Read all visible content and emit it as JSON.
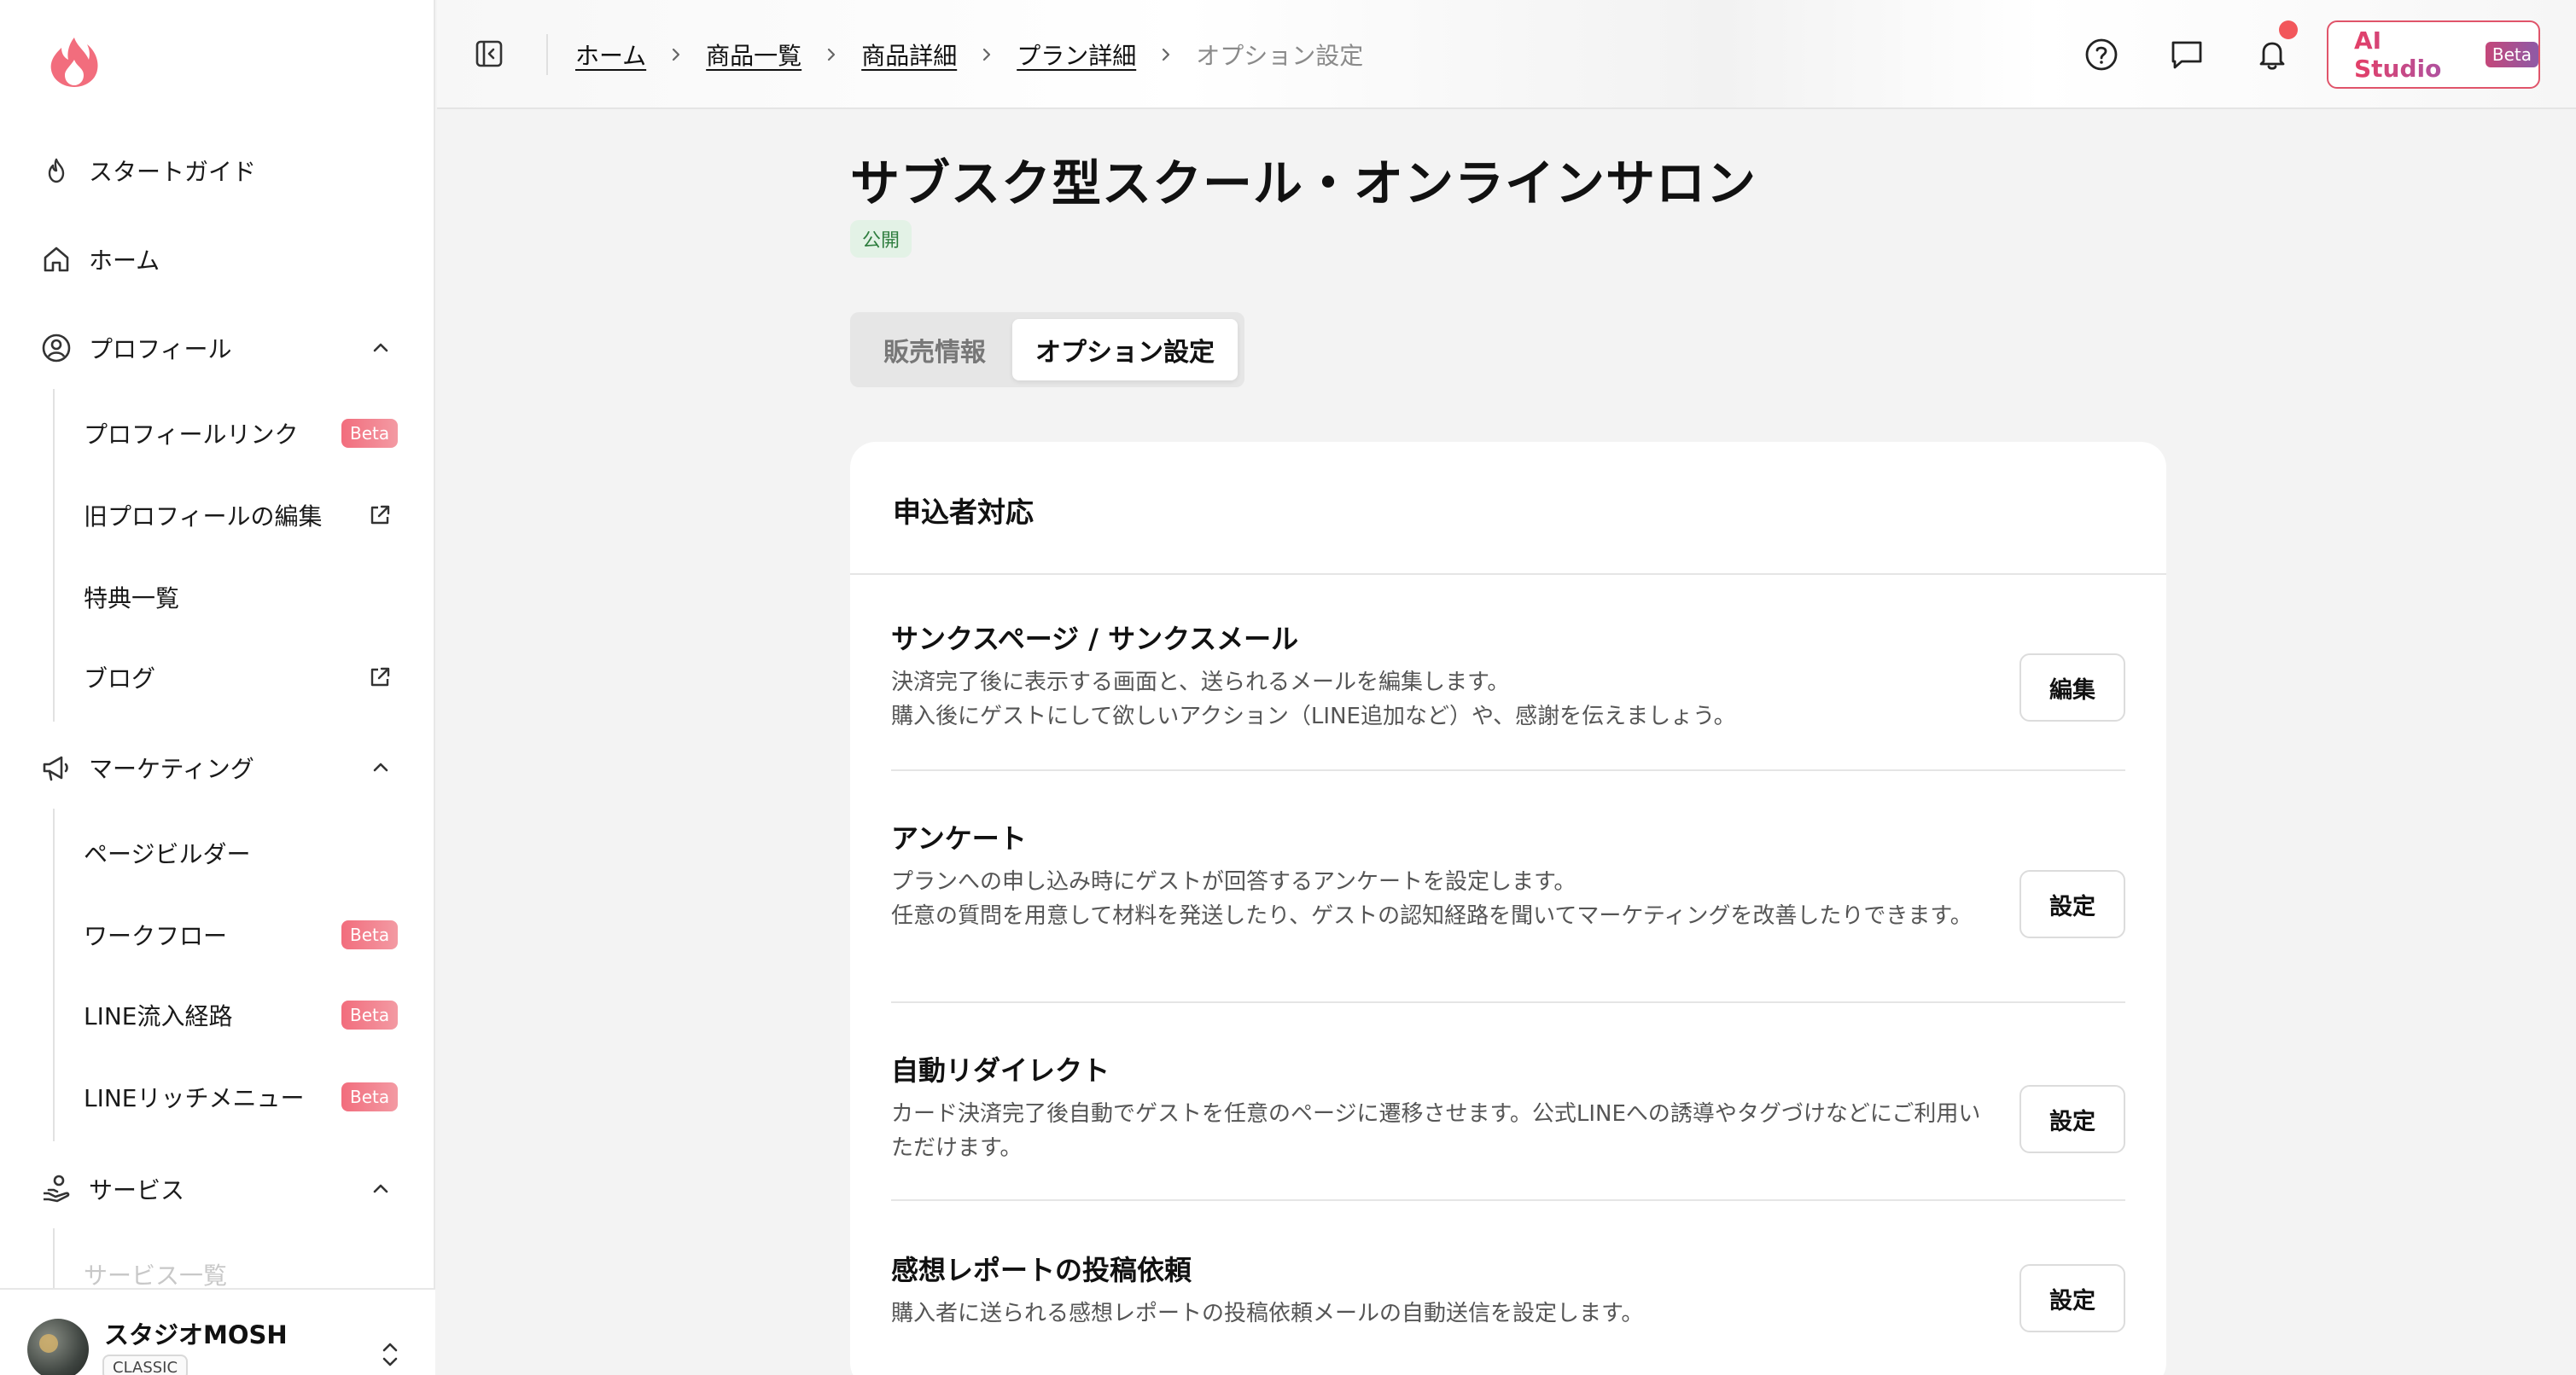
{
  "sidebar": {
    "logo_icon": "flame-logo-icon",
    "brand_color": "#f26d7d",
    "nav": {
      "start_guide": "スタートガイド",
      "home": "ホーム",
      "profile": "プロフィール",
      "marketing": "マーケティング",
      "services": "サービス"
    },
    "profile_items": [
      {
        "label": "プロフィールリンク",
        "badge": "Beta"
      },
      {
        "label": "旧プロフィールの編集",
        "icon": "external-link-icon"
      },
      {
        "label": "特典一覧"
      },
      {
        "label": "ブログ",
        "icon": "external-link-icon"
      }
    ],
    "marketing_items": [
      {
        "label": "ページビルダー"
      },
      {
        "label": "ワークフロー",
        "badge": "Beta"
      },
      {
        "label": "LINE流入経路",
        "badge": "Beta"
      },
      {
        "label": "LINEリッチメニュー",
        "badge": "Beta"
      }
    ],
    "services_items": [
      {
        "label": "サービス一覧"
      }
    ],
    "footer": {
      "name": "スタジオMOSH",
      "plan_tag": "CLASSIC"
    }
  },
  "header": {
    "breadcrumb": [
      "ホーム",
      "商品一覧",
      "商品詳細",
      "プラン詳細"
    ],
    "breadcrumb_current": "オプション設定",
    "icons": [
      "help-circle-icon",
      "chat-icon",
      "bell-icon"
    ],
    "ai_button": {
      "label": "AI Studio",
      "badge": "Beta"
    }
  },
  "main": {
    "title": "サブスク型スクール・オンラインサロン",
    "status": "公開",
    "tabs": [
      {
        "label": "販売情報",
        "active": false
      },
      {
        "label": "オプション設定",
        "active": true
      }
    ],
    "card": {
      "title": "申込者対応",
      "rows": [
        {
          "title": "サンクスページ / サンクスメール",
          "desc": "決済完了後に表示する画面と、送られるメールを編集します。\n購入後にゲストにして欲しいアクション（LINE追加など）や、感謝を伝えましょう。",
          "button": "編集"
        },
        {
          "title": "アンケート",
          "desc": "プランへの申し込み時にゲストが回答するアンケートを設定します。\n任意の質問を用意して材料を発送したり、ゲストの認知経路を聞いてマーケティングを改善したりできます。",
          "button": "設定"
        },
        {
          "title": "自動リダイレクト",
          "desc": "カード決済完了後自動でゲストを任意のページに遷移させます。公式LINEへの誘導やタグづけなどにご利用いただけます。",
          "button": "設定"
        },
        {
          "title": "感想レポートの投稿依頼",
          "desc": "購入者に送られる感想レポートの投稿依頼メールの自動送信を設定します。",
          "button": "設定"
        }
      ]
    }
  }
}
